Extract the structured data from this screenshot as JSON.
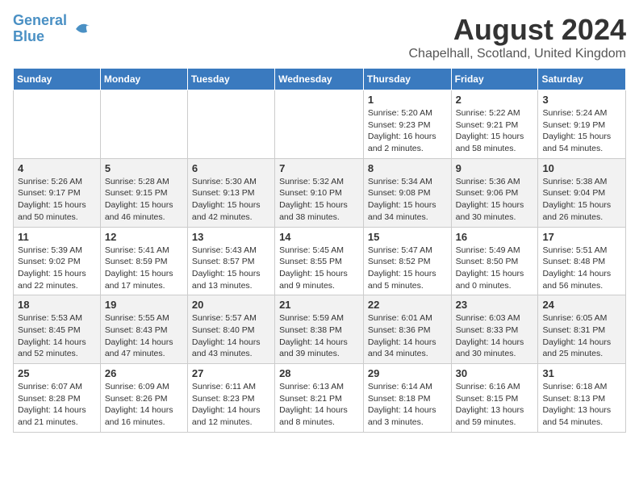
{
  "header": {
    "logo_line1": "General",
    "logo_line2": "Blue",
    "title": "August 2024",
    "subtitle": "Chapelhall, Scotland, United Kingdom"
  },
  "days_of_week": [
    "Sunday",
    "Monday",
    "Tuesday",
    "Wednesday",
    "Thursday",
    "Friday",
    "Saturday"
  ],
  "weeks": [
    [
      {
        "day": "",
        "info": ""
      },
      {
        "day": "",
        "info": ""
      },
      {
        "day": "",
        "info": ""
      },
      {
        "day": "",
        "info": ""
      },
      {
        "day": "1",
        "info": "Sunrise: 5:20 AM\nSunset: 9:23 PM\nDaylight: 16 hours and 2 minutes."
      },
      {
        "day": "2",
        "info": "Sunrise: 5:22 AM\nSunset: 9:21 PM\nDaylight: 15 hours and 58 minutes."
      },
      {
        "day": "3",
        "info": "Sunrise: 5:24 AM\nSunset: 9:19 PM\nDaylight: 15 hours and 54 minutes."
      }
    ],
    [
      {
        "day": "4",
        "info": "Sunrise: 5:26 AM\nSunset: 9:17 PM\nDaylight: 15 hours and 50 minutes."
      },
      {
        "day": "5",
        "info": "Sunrise: 5:28 AM\nSunset: 9:15 PM\nDaylight: 15 hours and 46 minutes."
      },
      {
        "day": "6",
        "info": "Sunrise: 5:30 AM\nSunset: 9:13 PM\nDaylight: 15 hours and 42 minutes."
      },
      {
        "day": "7",
        "info": "Sunrise: 5:32 AM\nSunset: 9:10 PM\nDaylight: 15 hours and 38 minutes."
      },
      {
        "day": "8",
        "info": "Sunrise: 5:34 AM\nSunset: 9:08 PM\nDaylight: 15 hours and 34 minutes."
      },
      {
        "day": "9",
        "info": "Sunrise: 5:36 AM\nSunset: 9:06 PM\nDaylight: 15 hours and 30 minutes."
      },
      {
        "day": "10",
        "info": "Sunrise: 5:38 AM\nSunset: 9:04 PM\nDaylight: 15 hours and 26 minutes."
      }
    ],
    [
      {
        "day": "11",
        "info": "Sunrise: 5:39 AM\nSunset: 9:02 PM\nDaylight: 15 hours and 22 minutes."
      },
      {
        "day": "12",
        "info": "Sunrise: 5:41 AM\nSunset: 8:59 PM\nDaylight: 15 hours and 17 minutes."
      },
      {
        "day": "13",
        "info": "Sunrise: 5:43 AM\nSunset: 8:57 PM\nDaylight: 15 hours and 13 minutes."
      },
      {
        "day": "14",
        "info": "Sunrise: 5:45 AM\nSunset: 8:55 PM\nDaylight: 15 hours and 9 minutes."
      },
      {
        "day": "15",
        "info": "Sunrise: 5:47 AM\nSunset: 8:52 PM\nDaylight: 15 hours and 5 minutes."
      },
      {
        "day": "16",
        "info": "Sunrise: 5:49 AM\nSunset: 8:50 PM\nDaylight: 15 hours and 0 minutes."
      },
      {
        "day": "17",
        "info": "Sunrise: 5:51 AM\nSunset: 8:48 PM\nDaylight: 14 hours and 56 minutes."
      }
    ],
    [
      {
        "day": "18",
        "info": "Sunrise: 5:53 AM\nSunset: 8:45 PM\nDaylight: 14 hours and 52 minutes."
      },
      {
        "day": "19",
        "info": "Sunrise: 5:55 AM\nSunset: 8:43 PM\nDaylight: 14 hours and 47 minutes."
      },
      {
        "day": "20",
        "info": "Sunrise: 5:57 AM\nSunset: 8:40 PM\nDaylight: 14 hours and 43 minutes."
      },
      {
        "day": "21",
        "info": "Sunrise: 5:59 AM\nSunset: 8:38 PM\nDaylight: 14 hours and 39 minutes."
      },
      {
        "day": "22",
        "info": "Sunrise: 6:01 AM\nSunset: 8:36 PM\nDaylight: 14 hours and 34 minutes."
      },
      {
        "day": "23",
        "info": "Sunrise: 6:03 AM\nSunset: 8:33 PM\nDaylight: 14 hours and 30 minutes."
      },
      {
        "day": "24",
        "info": "Sunrise: 6:05 AM\nSunset: 8:31 PM\nDaylight: 14 hours and 25 minutes."
      }
    ],
    [
      {
        "day": "25",
        "info": "Sunrise: 6:07 AM\nSunset: 8:28 PM\nDaylight: 14 hours and 21 minutes."
      },
      {
        "day": "26",
        "info": "Sunrise: 6:09 AM\nSunset: 8:26 PM\nDaylight: 14 hours and 16 minutes."
      },
      {
        "day": "27",
        "info": "Sunrise: 6:11 AM\nSunset: 8:23 PM\nDaylight: 14 hours and 12 minutes."
      },
      {
        "day": "28",
        "info": "Sunrise: 6:13 AM\nSunset: 8:21 PM\nDaylight: 14 hours and 8 minutes."
      },
      {
        "day": "29",
        "info": "Sunrise: 6:14 AM\nSunset: 8:18 PM\nDaylight: 14 hours and 3 minutes."
      },
      {
        "day": "30",
        "info": "Sunrise: 6:16 AM\nSunset: 8:15 PM\nDaylight: 13 hours and 59 minutes."
      },
      {
        "day": "31",
        "info": "Sunrise: 6:18 AM\nSunset: 8:13 PM\nDaylight: 13 hours and 54 minutes."
      }
    ]
  ]
}
